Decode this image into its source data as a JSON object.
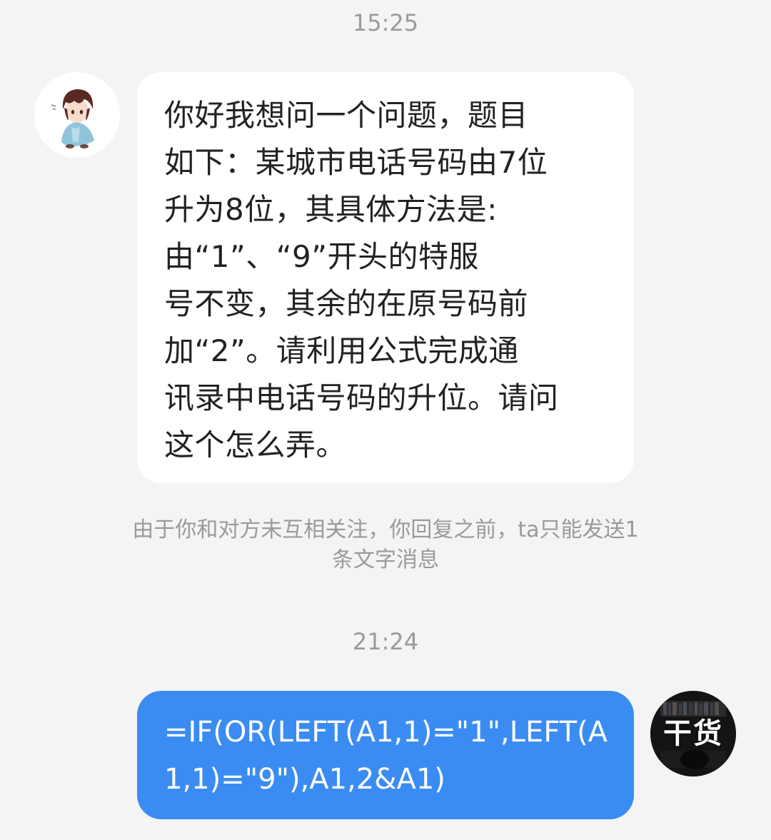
{
  "conversation": {
    "timestamp_1": "15:25",
    "incoming_message": "你好我想问一个问题，题目\n如下：某城市电话号码由7位\n升为8位，其具体方法是:\n由“1”、“9”开头的特服\n号不变，其余的在原号码前\n加“2”。请利用公式完成通\n讯录中电话号码的升位。请问\n这个怎么弄。",
    "system_notice": "由于你和对方未互相关注，你回复之前，ta只能发送1\n条文字消息",
    "timestamp_2": "21:24",
    "outgoing_message": "=IF(OR(LEFT(A1,1)=\"1\",LEFT(A\n1,1)=\"9\"),A1,2&A1)",
    "outgoing_avatar_text": "干货"
  },
  "colors": {
    "background": "#f4f4f4",
    "incoming_bubble": "#ffffff",
    "outgoing_bubble": "#3b8cf2",
    "meta_text": "#9a9a9a"
  }
}
